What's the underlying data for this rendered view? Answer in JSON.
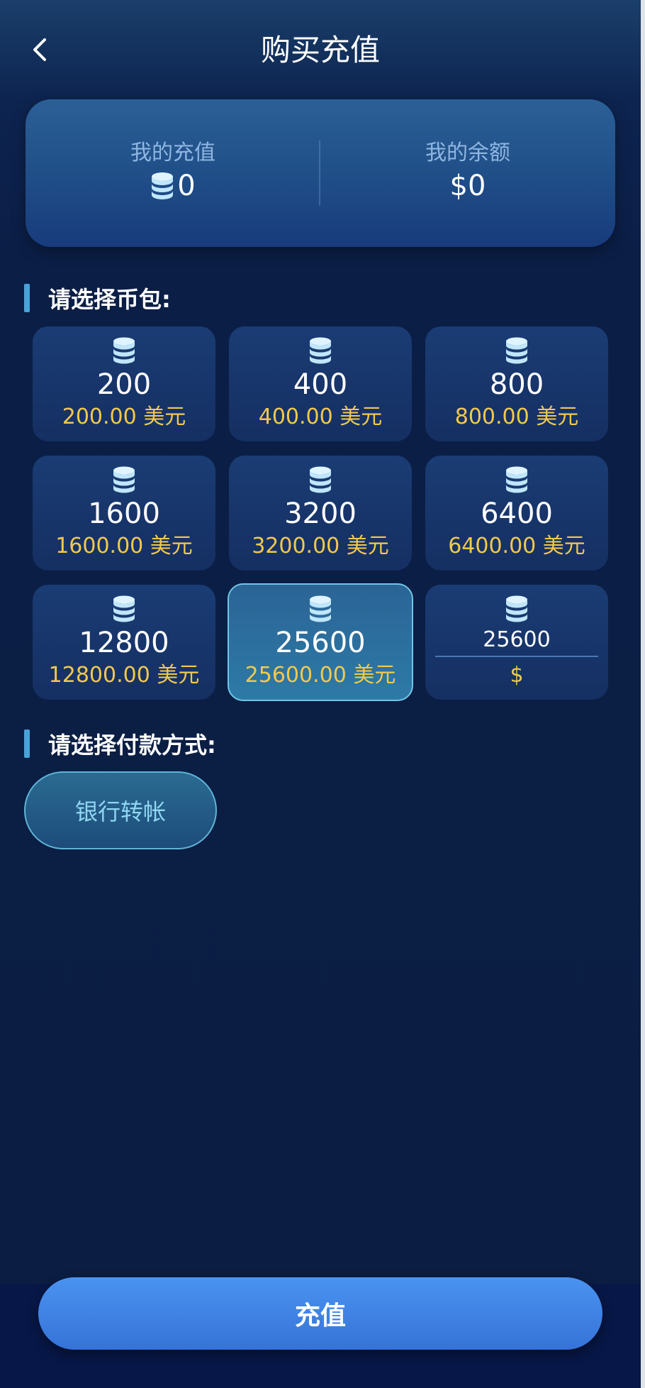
{
  "header": {
    "title": "购买充值",
    "back_icon": "chevron-left-icon"
  },
  "summary": {
    "recharge_label": "我的充值",
    "recharge_value": "0",
    "balance_label": "我的余额",
    "balance_value": "$0",
    "coin_icon": "coin-stack-icon"
  },
  "packages_section": {
    "title": "请选择币包:"
  },
  "packages": [
    {
      "coins": "200",
      "price": "200.00 美元",
      "selected": false
    },
    {
      "coins": "400",
      "price": "400.00 美元",
      "selected": false
    },
    {
      "coins": "800",
      "price": "800.00 美元",
      "selected": false
    },
    {
      "coins": "1600",
      "price": "1600.00 美元",
      "selected": false
    },
    {
      "coins": "3200",
      "price": "3200.00 美元",
      "selected": false
    },
    {
      "coins": "6400",
      "price": "6400.00 美元",
      "selected": false
    },
    {
      "coins": "12800",
      "price": "12800.00 美元",
      "selected": false
    },
    {
      "coins": "25600",
      "price": "25600.00 美元",
      "selected": true
    }
  ],
  "custom_package": {
    "value": "25600",
    "currency": "$"
  },
  "payment_section": {
    "title": "请选择付款方式:"
  },
  "payment_methods": [
    {
      "label": "银行转帐"
    }
  ],
  "footer": {
    "submit_label": "充值"
  },
  "colors": {
    "accent_gold": "#f2c94c",
    "selected_border": "#6fc6e6",
    "button_blue": "#4a93f0"
  }
}
